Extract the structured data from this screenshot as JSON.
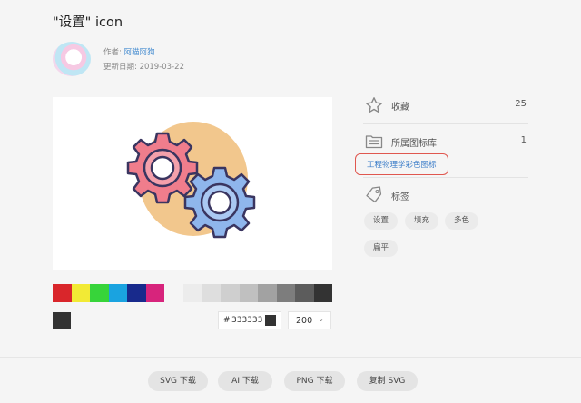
{
  "header": {
    "title": "\"设置\" icon"
  },
  "author": {
    "author_label": "作者:",
    "author_name": "阿猫阿狗",
    "date_label": "更新日期:",
    "date_value": "2019-03-22"
  },
  "icon_preview": {
    "icon": "gears-settings-icon",
    "colors": {
      "blob": "#f2c78d",
      "gear_pink": "#f07d8c",
      "gear_blue": "#8fb6ec",
      "outline": "#3a3560"
    }
  },
  "palette": {
    "bright": [
      "#d9262b",
      "#f2ea35",
      "#37d43a",
      "#1aa3e0",
      "#182a8c",
      "#d7247c"
    ],
    "grays": [
      "#ececec",
      "#dedede",
      "#cfcfcf",
      "#c0c0c0",
      "#a2a2a2",
      "#7d7d7d",
      "#5c5c5c",
      "#333333"
    ]
  },
  "color_input": {
    "hash": "#",
    "value": "333333",
    "color": "#333333"
  },
  "size_select": {
    "value": "200",
    "chevron_icon": "chevron-down-icon"
  },
  "sidebar": {
    "favorites": {
      "icon": "star-icon",
      "label": "收藏",
      "count": "25"
    },
    "library": {
      "icon": "library-icon",
      "label": "所属图标库",
      "count": "1",
      "link": "工程物理学彩色图标"
    },
    "tags": {
      "icon": "tag-icon",
      "label": "标签",
      "items": [
        "设置",
        "填充",
        "多色",
        "扁平"
      ]
    }
  },
  "footer": {
    "buttons": [
      "SVG 下载",
      "AI 下载",
      "PNG 下载",
      "复制 SVG"
    ]
  }
}
